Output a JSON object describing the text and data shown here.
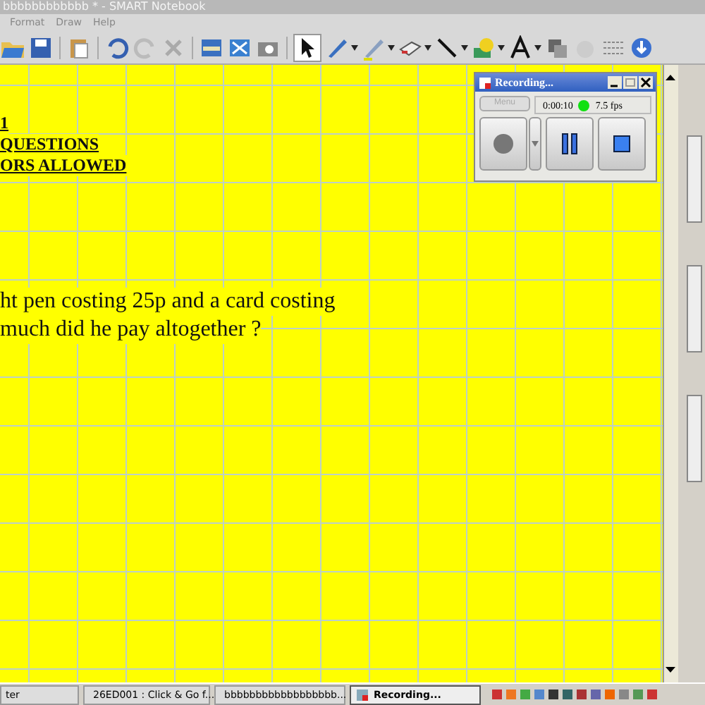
{
  "window": {
    "title": "bbbbbbbbbbbb * - SMART Notebook"
  },
  "menu": [
    "Format",
    "Draw",
    "Help"
  ],
  "page": {
    "heading_lines": [
      "1",
      "QUESTIONS",
      "ORS ALLOWED"
    ],
    "question_lines": [
      "ht pen costing 25p and a card costing",
      "much did he pay altogether ?"
    ]
  },
  "recorder": {
    "title": "Recording...",
    "menu_button": "Menu",
    "elapsed": "0:00:10",
    "frame_rate": "7.5 fps"
  },
  "taskbar": {
    "items": [
      {
        "label": "ter",
        "selected": false
      },
      {
        "label": "26ED001 : Click & Go f...",
        "selected": false
      },
      {
        "label": "bbbbbbbbbbbbbbbbbb...",
        "selected": false
      },
      {
        "label": "Recording...",
        "selected": true
      }
    ]
  }
}
